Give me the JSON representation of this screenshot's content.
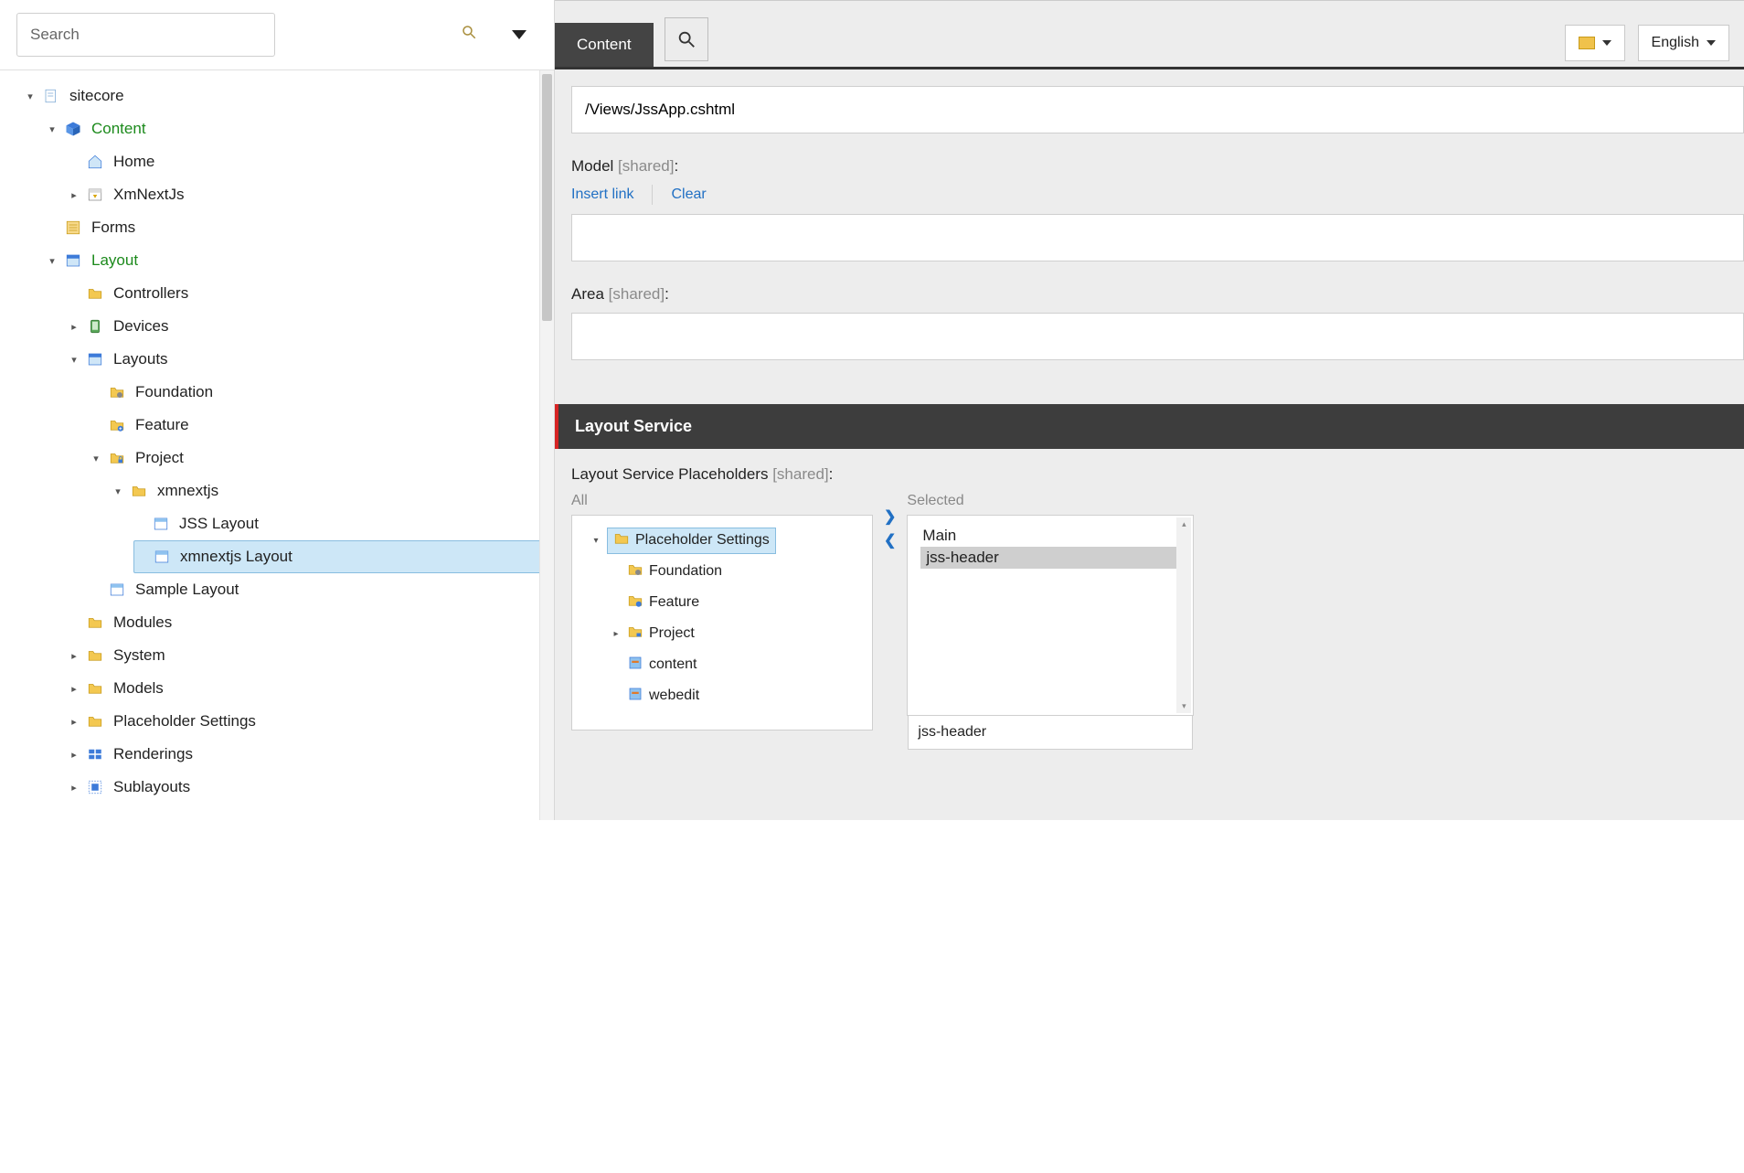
{
  "search": {
    "placeholder": "Search"
  },
  "ribbon": {
    "tab_content": "Content",
    "language": "English"
  },
  "fields": {
    "views_value": "/Views/JssApp.cshtml",
    "model_label": "Model",
    "shared": " [shared]",
    "shared_colon": ":",
    "insert_link": "Insert link",
    "clear": "Clear",
    "area_label": "Area"
  },
  "section": {
    "layout_service": "Layout Service",
    "lsp_label": "Layout Service Placeholders",
    "all": "All",
    "selected": "Selected"
  },
  "all_tree": {
    "root": "Placeholder Settings",
    "foundation": "Foundation",
    "feature": "Feature",
    "project": "Project",
    "content": "content",
    "webedit": "webedit"
  },
  "selected_list": {
    "main": "Main",
    "jss_header": "jss-header",
    "footer_value": "jss-header"
  },
  "tree": {
    "sitecore": "sitecore",
    "content": "Content",
    "home": "Home",
    "xmnextjs": "XmNextJs",
    "forms": "Forms",
    "layout": "Layout",
    "controllers": "Controllers",
    "devices": "Devices",
    "layouts": "Layouts",
    "foundation": "Foundation",
    "feature": "Feature",
    "project": "Project",
    "xmnextjs_folder": "xmnextjs",
    "jss_layout": "JSS Layout",
    "xmnextjs_layout": "xmnextjs Layout",
    "sample_layout": "Sample Layout",
    "modules": "Modules",
    "system": "System",
    "models": "Models",
    "placeholder_settings": "Placeholder Settings",
    "renderings": "Renderings",
    "sublayouts": "Sublayouts"
  }
}
